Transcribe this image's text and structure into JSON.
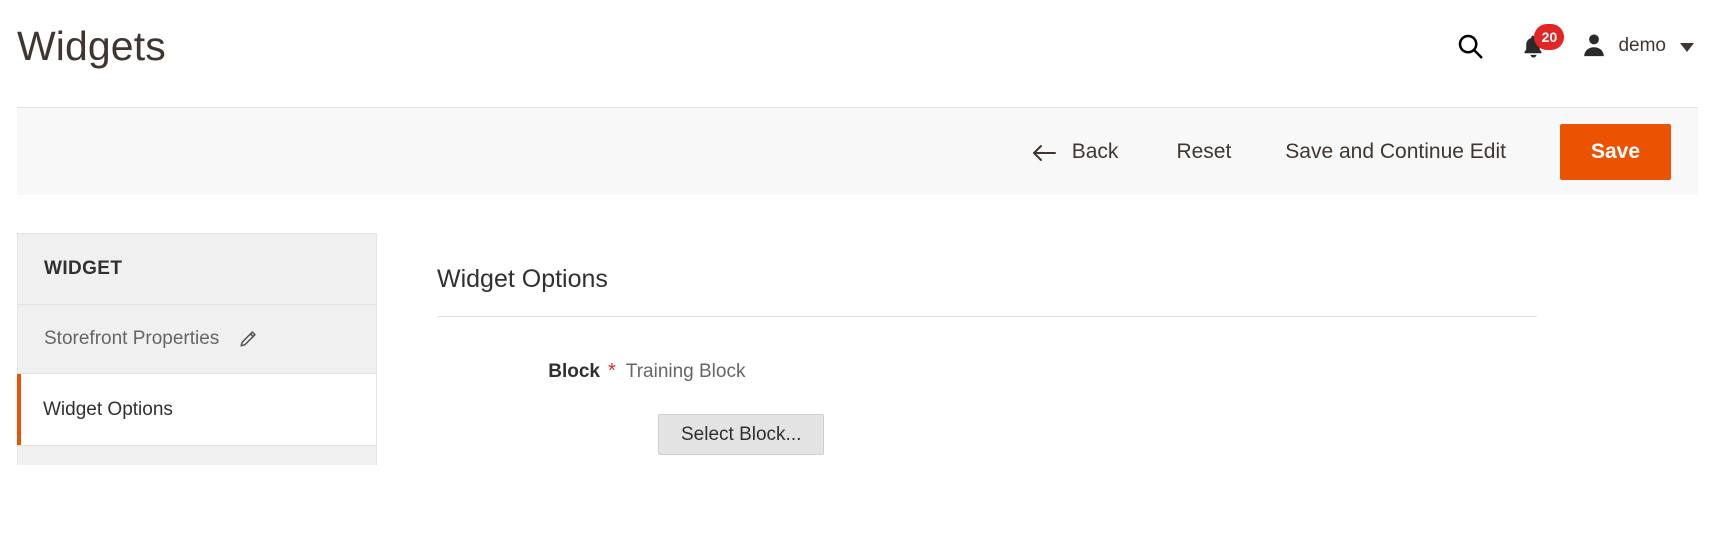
{
  "header": {
    "title": "Widgets",
    "search_icon": "search-icon",
    "notifications": {
      "icon": "bell-icon",
      "count": "20",
      "badge_color": "#e22626"
    },
    "user": {
      "icon": "user-avatar-icon",
      "name": "demo",
      "caret": "chevron-down-icon"
    }
  },
  "toolbar": {
    "back_label": "Back",
    "back_icon": "arrow-left-icon",
    "reset_label": "Reset",
    "save_continue_label": "Save and Continue Edit",
    "save_label": "Save",
    "save_color": "#eb5202"
  },
  "sidebar": {
    "section_title": "WIDGET",
    "items": [
      {
        "label": "Storefront Properties",
        "icon": "pencil-edit-icon",
        "active": false
      },
      {
        "label": "Widget Options",
        "icon": "",
        "active": true
      }
    ],
    "active_accent_color": "#eb5202"
  },
  "main": {
    "heading": "Widget Options",
    "fields": [
      {
        "label": "Block",
        "required_mark": "*",
        "value": "Training Block"
      }
    ],
    "select_block_label": "Select Block..."
  }
}
